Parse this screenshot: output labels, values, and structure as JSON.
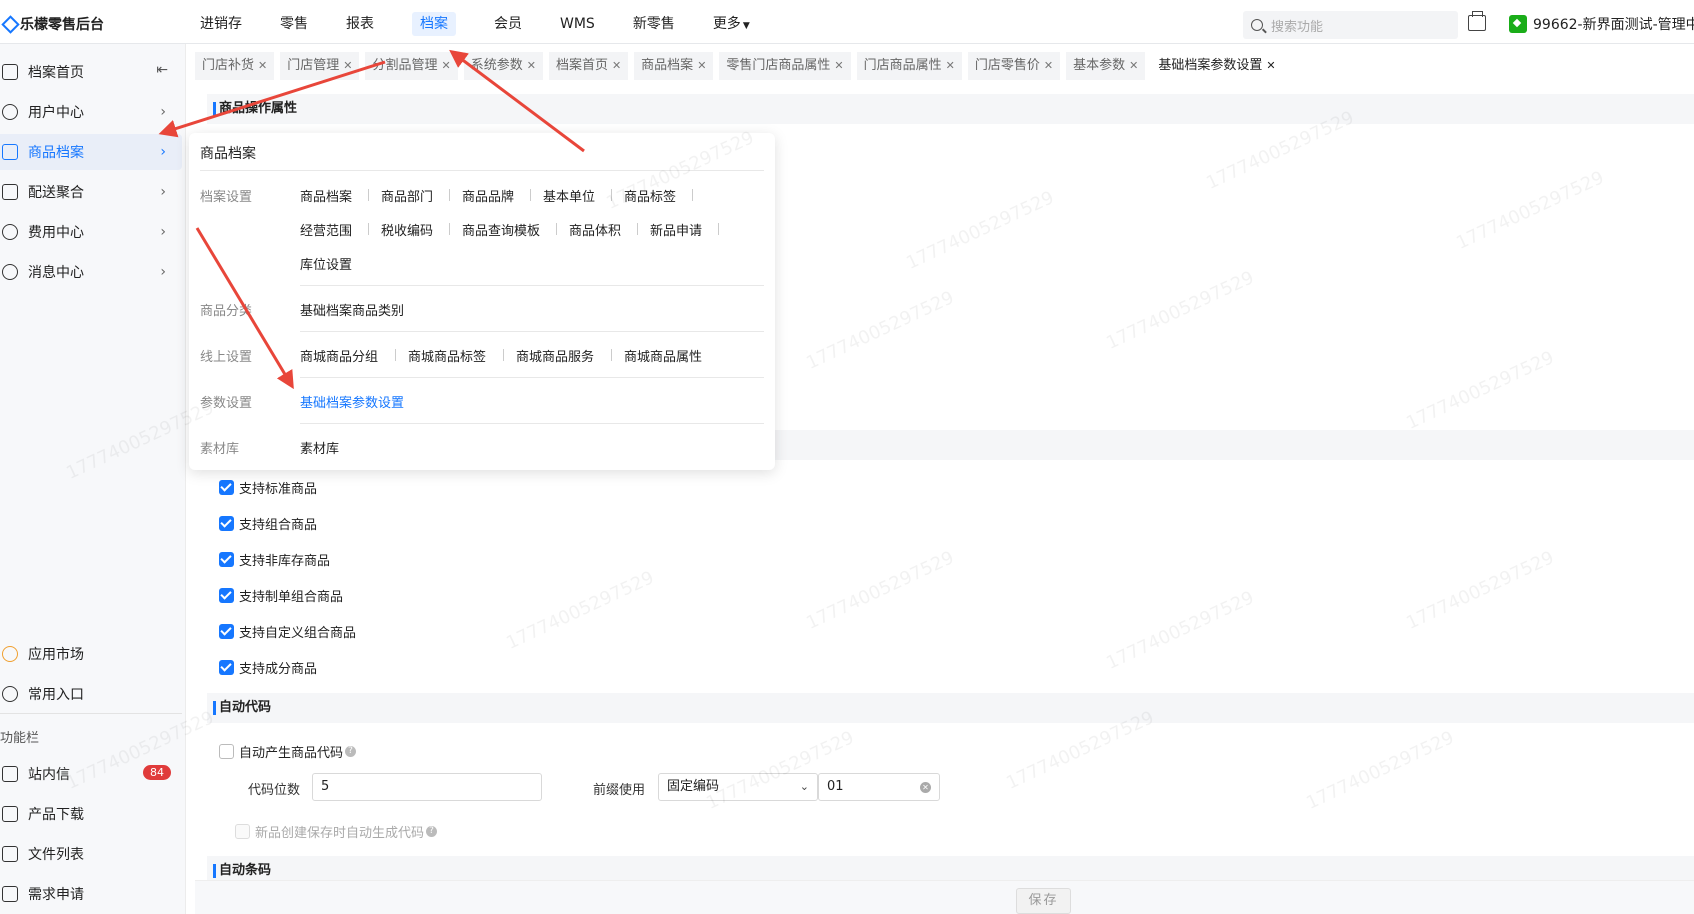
{
  "app": {
    "title": "乐檬零售后台"
  },
  "topnav": [
    "进销存",
    "零售",
    "报表",
    "档案",
    "会员",
    "WMS",
    "新零售",
    "更多"
  ],
  "topnav_active": "档案",
  "search": {
    "placeholder": "搜索功能"
  },
  "store": {
    "label": "99662-新界面测试-管理中"
  },
  "sidebar": {
    "items": [
      {
        "label": "档案首页"
      },
      {
        "label": "用户中心"
      },
      {
        "label": "商品档案"
      },
      {
        "label": "配送聚合"
      },
      {
        "label": "费用中心"
      },
      {
        "label": "消息中心"
      }
    ],
    "bottom_items": [
      {
        "label": "应用市场"
      },
      {
        "label": "常用入口"
      }
    ],
    "section_label": "功能栏",
    "function_items": [
      {
        "label": "站内信",
        "badge": "84"
      },
      {
        "label": "产品下载"
      },
      {
        "label": "文件列表"
      },
      {
        "label": "需求申请"
      }
    ]
  },
  "tabs": [
    "门店补货",
    "门店管理",
    "分割品管理",
    "系统参数",
    "档案首页",
    "商品档案",
    "零售门店商品属性",
    "门店商品属性",
    "门店零售价",
    "基本参数",
    "基础档案参数设置"
  ],
  "tab_active": "基础档案参数设置",
  "sections": {
    "product_attr": {
      "title": "商品操作属性"
    },
    "checkboxes": [
      "支持标准商品",
      "支持组合商品",
      "支持非库存商品",
      "支持制单组合商品",
      "支持自定义组合商品",
      "支持成分商品"
    ],
    "auto_code": {
      "title": "自动代码",
      "auto_generate_label": "自动产生商品代码",
      "digits_label": "代码位数",
      "digits_value": "5",
      "prefix_label": "前缀使用",
      "prefix_select": "固定编码",
      "prefix_value": "01",
      "new_item_label": "新品创建保存时自动生成代码"
    },
    "auto_barcode": {
      "title": "自动条码"
    }
  },
  "save_label": "保存",
  "dropdown": {
    "title": "商品档案",
    "groups": [
      {
        "label": "档案设置",
        "rows": [
          [
            "商品档案",
            "商品部门",
            "商品品牌",
            "基本单位",
            "商品标签"
          ],
          [
            "经营范围",
            "税收编码",
            "商品查询模板",
            "商品体积",
            "新品申请"
          ],
          [
            "库位设置"
          ]
        ]
      },
      {
        "label": "商品分类",
        "rows": [
          [
            "基础档案商品类别"
          ]
        ]
      },
      {
        "label": "线上设置",
        "rows": [
          [
            "商城商品分组",
            "商城商品标签",
            "商城商品服务",
            "商城商品属性"
          ]
        ]
      },
      {
        "label": "参数设置",
        "rows": [
          [
            "基础档案参数设置"
          ]
        ]
      },
      {
        "label": "素材库",
        "rows": [
          [
            "素材库"
          ]
        ]
      }
    ]
  },
  "watermark": "17774005297529"
}
